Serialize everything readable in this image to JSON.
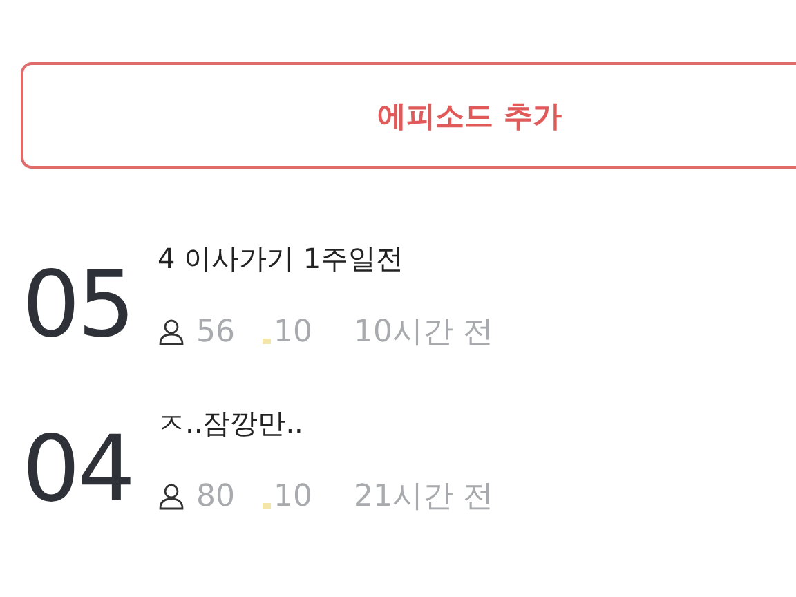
{
  "add_button": {
    "label": "에피소드 추가"
  },
  "episodes": [
    {
      "number": "05",
      "title": "4 이사가기 1주일전",
      "views": "56",
      "likes": "10",
      "time": "10시간 전"
    },
    {
      "number": "04",
      "title": "ㅈ..잠깡만..",
      "views": "80",
      "likes": "10",
      "time": "21시간 전"
    }
  ]
}
